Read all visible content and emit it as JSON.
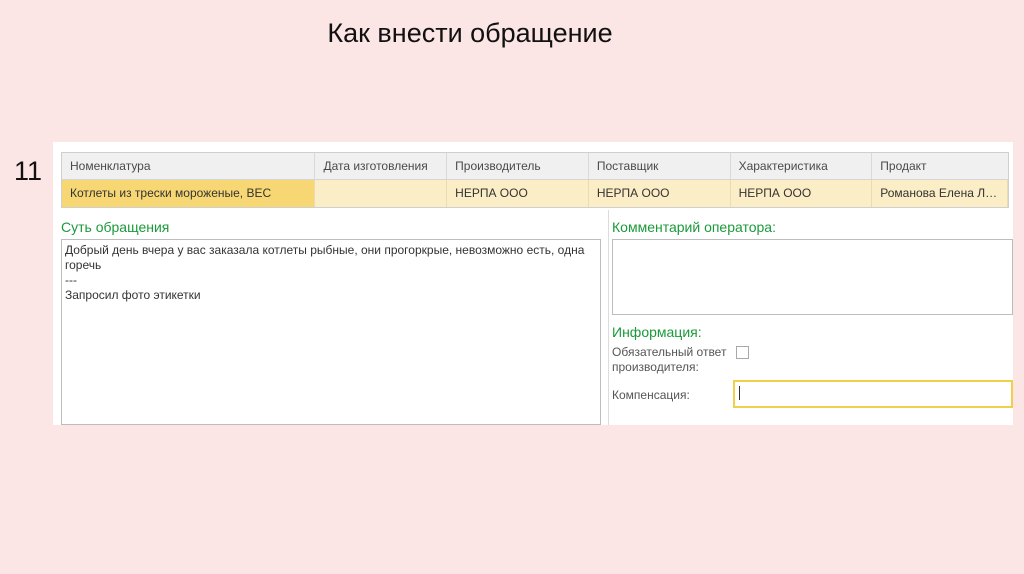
{
  "slide": {
    "title": "Как внести обращение",
    "number": "11"
  },
  "table": {
    "columns": [
      "Номенклатура",
      "Дата изготовления",
      "Производитель",
      "Поставщик",
      "Характеристика",
      "Продакт"
    ],
    "rows": [
      [
        "Котлеты из трески мороженые, ВЕС",
        "",
        "НЕРПА ООО",
        "НЕРПА ООО",
        "НЕРПА ООО",
        "Романова Елена Ле..."
      ]
    ]
  },
  "appeal": {
    "label": "Суть обращения",
    "text": "Добрый день вчера у вас заказала котлеты рыбные, они прогоркрые, невозможно есть, одна горечь\n---\nЗапросил фото этикетки"
  },
  "operator_comment": {
    "label": "Комментарий оператора:",
    "value": ""
  },
  "info": {
    "label": "Информация:",
    "mandatory_label": "Обязательный ответ производителя:",
    "mandatory_checked": false,
    "compensation_label": "Компенсация:",
    "compensation_value": ""
  },
  "colors": {
    "background": "#fbe5e5",
    "section_label": "#1a9a3a",
    "selected_row": "#fbedc5",
    "selected_cell": "#f7d774",
    "focus_border": "#f2cf4a"
  }
}
